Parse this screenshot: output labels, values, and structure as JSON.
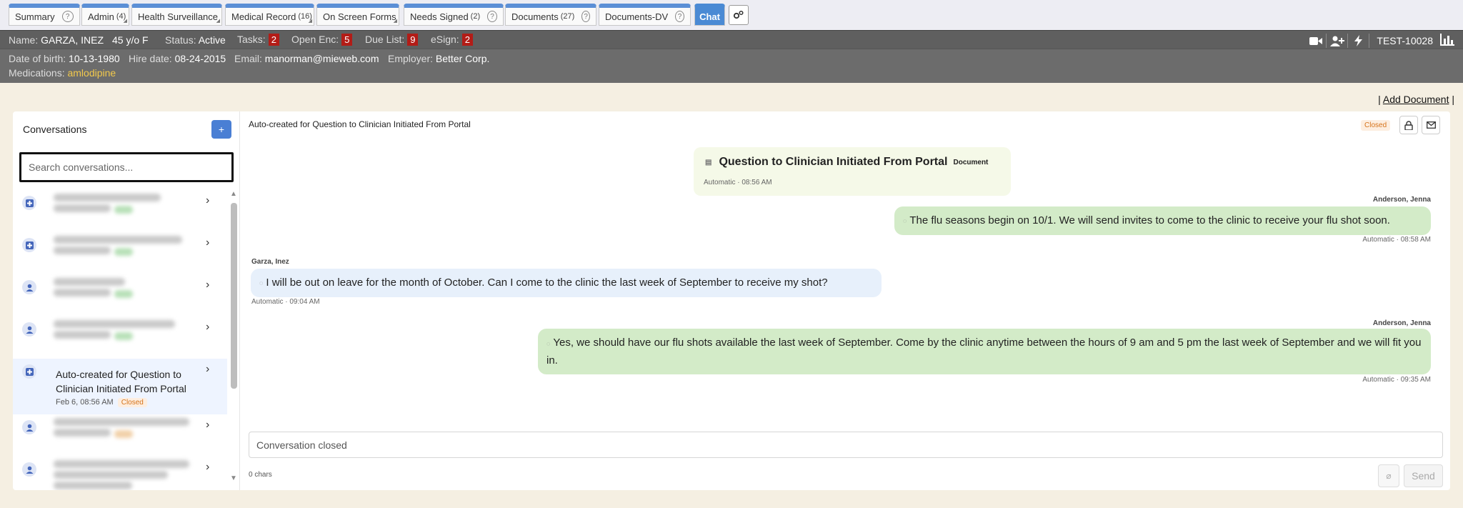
{
  "tabs": [
    {
      "label": "Summary",
      "count": "",
      "help": true
    },
    {
      "label": "Admin",
      "count": "(4)",
      "help": false
    },
    {
      "label": "Health Surveillance",
      "count": "",
      "help": false
    },
    {
      "label": "Medical Record",
      "count": "(16)",
      "help": false
    },
    {
      "label": "On Screen Forms",
      "count": "",
      "help": false
    },
    {
      "label": "Needs Signed",
      "count": "(2)",
      "help": true
    },
    {
      "label": "Documents",
      "count": "(27)",
      "help": true
    },
    {
      "label": "Documents-DV",
      "count": "",
      "help": true
    },
    {
      "label": "Chat",
      "count": "",
      "help": false
    }
  ],
  "patient": {
    "name_label": "Name:",
    "name": "GARZA, INEZ",
    "age_sex": "45 y/o F",
    "status_label": "Status:",
    "status": "Active",
    "tasks_label": "Tasks:",
    "tasks": "2",
    "open_enc_label": "Open Enc:",
    "open_enc": "5",
    "due_list_label": "Due List:",
    "due_list": "9",
    "esign_label": "eSign:",
    "esign": "2",
    "dob_label": "Date of birth:",
    "dob": "10-13-1980",
    "hire_label": "Hire date:",
    "hire": "08-24-2015",
    "email_label": "Email:",
    "email": "manorman@mieweb.com",
    "employer_label": "Employer:",
    "employer": "Better Corp.",
    "med_label": "Medications:",
    "meds": "amlodipine",
    "test_id": "TEST-10028"
  },
  "add_document": "Add Document",
  "sidebar": {
    "title": "Conversations",
    "add_label": "+",
    "search_placeholder": "Search conversations...",
    "selected": {
      "title": "Auto-created for Question to Clinician Initiated From Portal",
      "date": "Feb 6, 08:56 AM",
      "status": "Closed"
    }
  },
  "chat": {
    "title": "Auto-created for Question to Clinician Initiated From Portal",
    "status": "Closed",
    "document": {
      "title": "Question to Clinician Initiated From Portal",
      "tag": "Document",
      "meta": "Automatic · 08:56 AM"
    },
    "messages": [
      {
        "sender": "Anderson, Jenna",
        "text": "The flu seasons begin on 10/1. We will send invites to come to the clinic to receive your flu shot soon.",
        "meta": "Automatic · 08:58 AM"
      },
      {
        "sender": "Garza, Inez",
        "text": "I will be out on leave for the month of October. Can I come to the clinic the last week of September to receive my shot?",
        "meta": "Automatic · 09:04 AM"
      },
      {
        "sender": "Anderson, Jenna",
        "text": "Yes, we should have our flu shots available the last week of September. Come by the clinic anytime between the hours of 9 am and 5 pm the last week of September and we will fit you in.",
        "meta": "Automatic · 09:35 AM"
      }
    ],
    "composer_placeholder": "Conversation closed",
    "char_count": "0 chars",
    "send_label": "Send"
  }
}
